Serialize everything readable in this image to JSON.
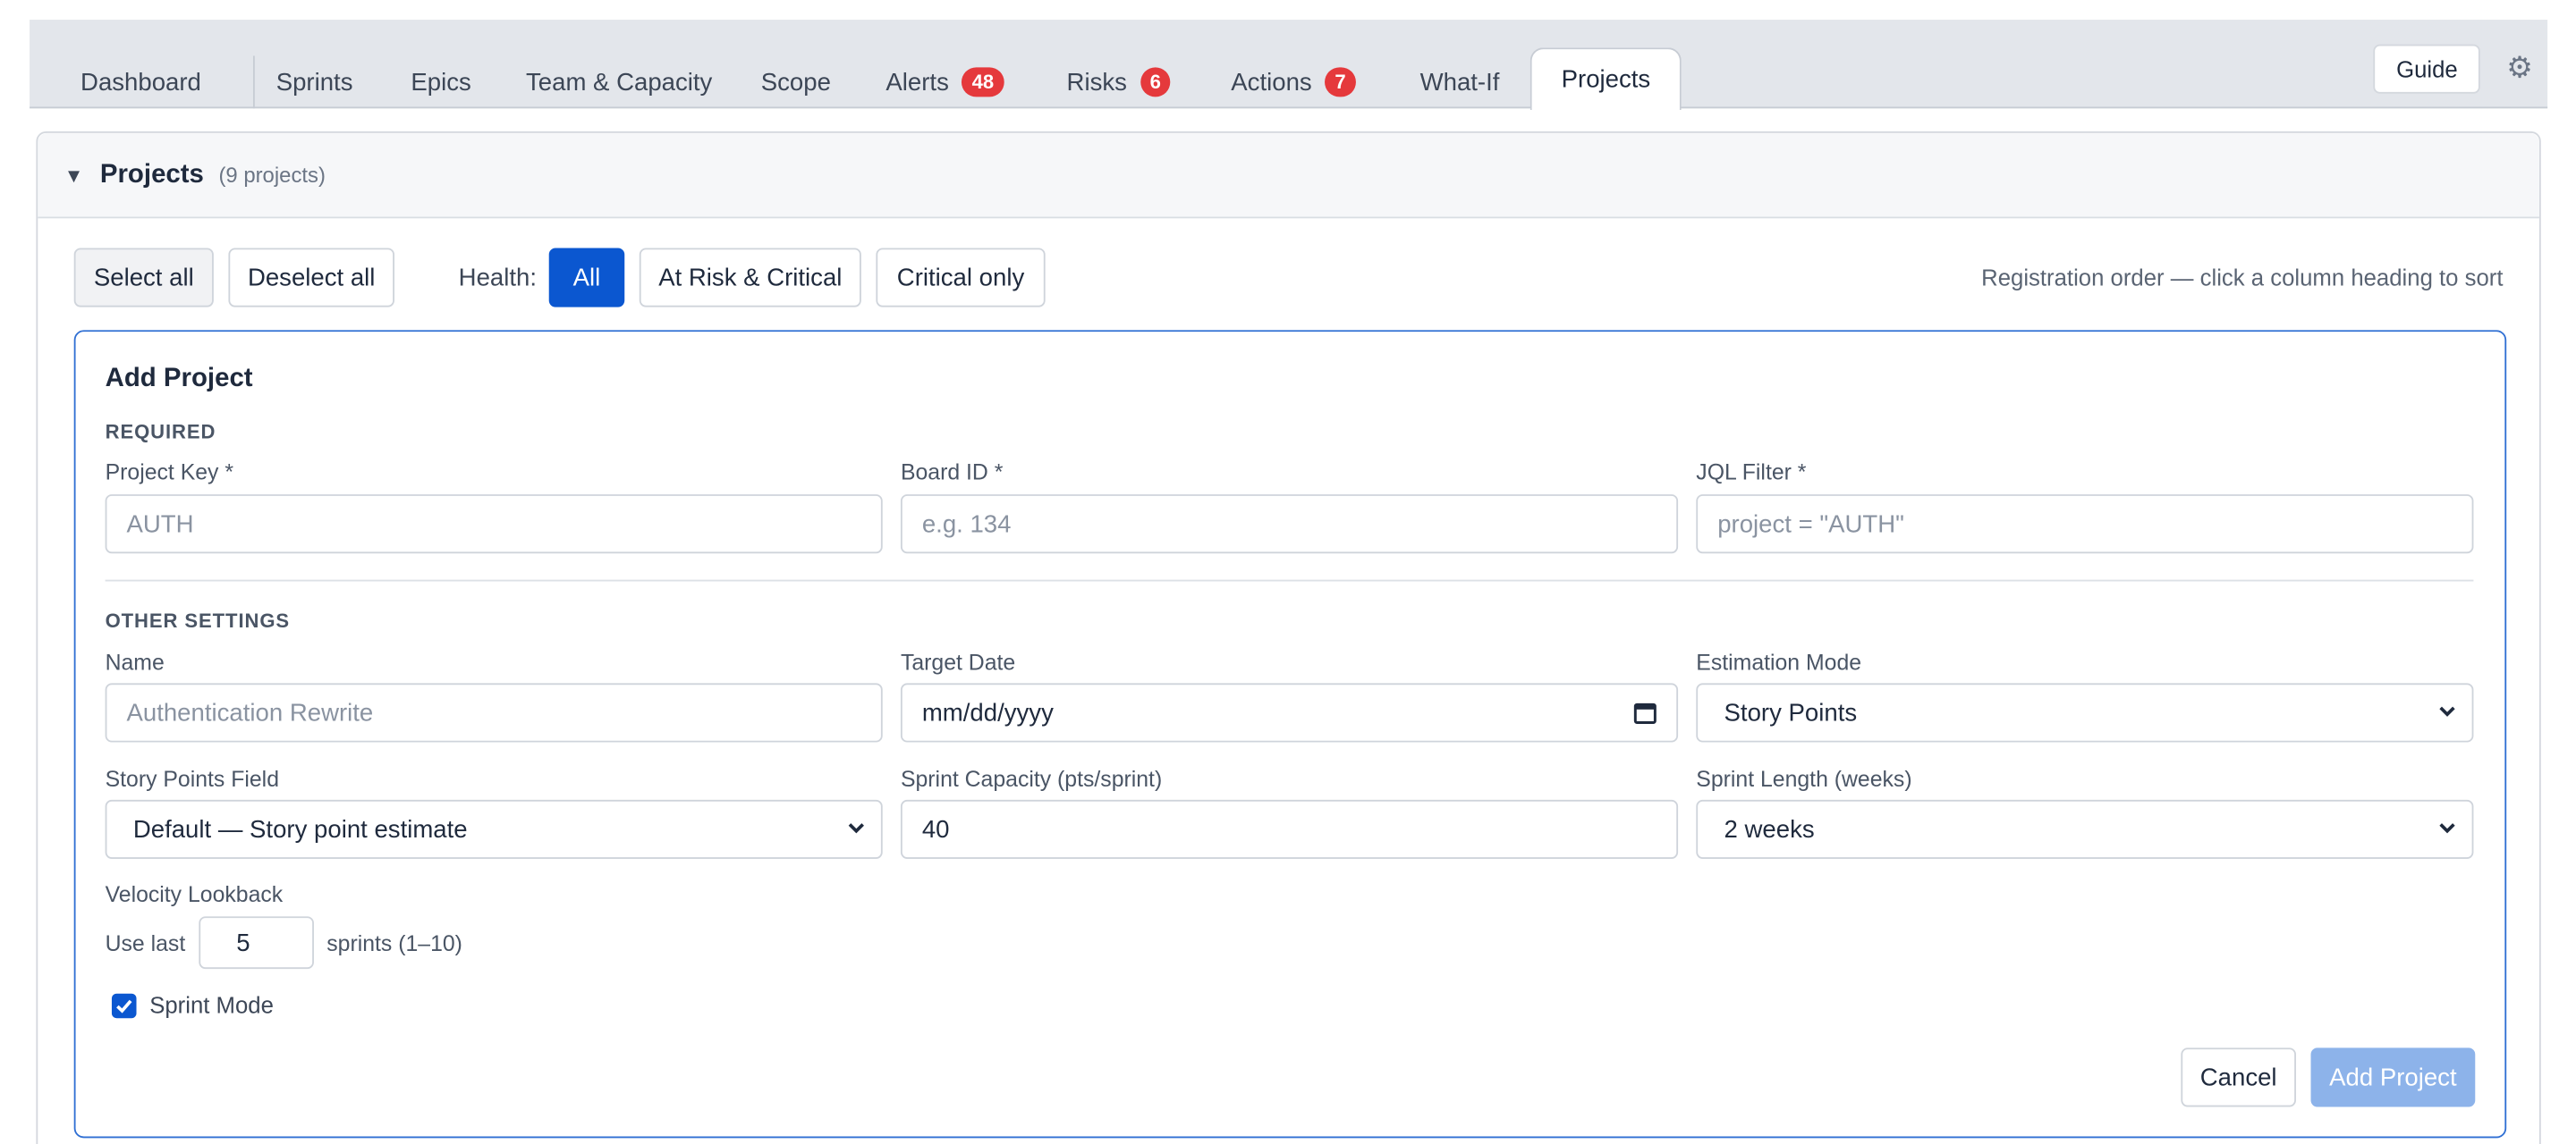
{
  "tabs": [
    {
      "label": "Dashboard"
    },
    {
      "label": "Sprints"
    },
    {
      "label": "Epics"
    },
    {
      "label": "Team & Capacity"
    },
    {
      "label": "Scope"
    },
    {
      "label": "Alerts",
      "badge": "48"
    },
    {
      "label": "Risks",
      "badge": "6"
    },
    {
      "label": "Actions",
      "badge": "7"
    },
    {
      "label": "What-If"
    },
    {
      "label": "Projects"
    }
  ],
  "header": {
    "guide_label": "Guide",
    "settings_icon": "gear-icon"
  },
  "panel": {
    "title": "Projects",
    "count": "(9 projects)"
  },
  "toolbar": {
    "select_all": "Select all",
    "deselect_all": "Deselect all",
    "health_label": "Health:",
    "health_options": [
      "All",
      "At Risk & Critical",
      "Critical only"
    ],
    "health_selected": "All",
    "sort_hint": "Registration order — click a column heading to sort"
  },
  "form": {
    "title": "Add Project",
    "required_label": "REQUIRED",
    "project_key": {
      "label": "Project Key *",
      "placeholder": "AUTH"
    },
    "board_id": {
      "label": "Board ID *",
      "placeholder": "e.g. 134"
    },
    "jql_filter": {
      "label": "JQL Filter *",
      "placeholder": "project = \"AUTH\""
    },
    "other_label": "OTHER SETTINGS",
    "name": {
      "label": "Name",
      "placeholder": "Authentication Rewrite"
    },
    "target_date": {
      "label": "Target Date",
      "value": "mm/dd/yyyy"
    },
    "estimation_mode": {
      "label": "Estimation Mode",
      "value": "Story Points"
    },
    "story_points_field": {
      "label": "Story Points Field",
      "value": "Default — Story point estimate"
    },
    "sprint_capacity": {
      "label": "Sprint Capacity (pts/sprint)",
      "value": "40"
    },
    "sprint_length": {
      "label": "Sprint Length (weeks)",
      "value": "2 weeks"
    },
    "velocity": {
      "label": "Velocity Lookback",
      "prefix": "Use last",
      "value": "5",
      "suffix": "sprints (1–10)"
    },
    "sprint_mode": {
      "label": "Sprint Mode",
      "checked": true
    },
    "cancel_label": "Cancel",
    "submit_label": "Add Project"
  },
  "colors": {
    "accent": "#0b57d0",
    "badge": "#e5393c",
    "submit_disabled": "#8db3ea"
  }
}
